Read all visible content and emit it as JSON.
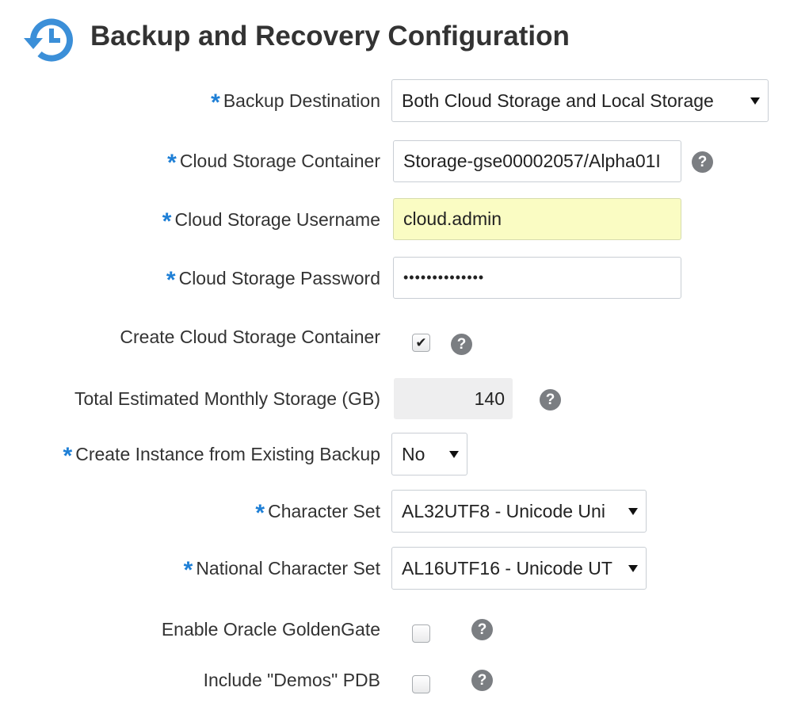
{
  "header": {
    "title": "Backup and Recovery Configuration",
    "icon": "backup-restore-clock-icon",
    "icon_color": "#3b8fd8"
  },
  "colors": {
    "required_marker": "#1e7fd6",
    "highlight_field": "#fafcc3",
    "readonly_field": "#eeeeef",
    "help_icon": "#7b7e82"
  },
  "form": {
    "required_marker": "*",
    "help_glyph": "?",
    "backup_destination": {
      "label": "Backup Destination",
      "value": "Both Cloud Storage and Local Storage",
      "required": true
    },
    "cloud_storage_container": {
      "label": "Cloud Storage Container",
      "value": "Storage-gse00002057/Alpha01I",
      "required": true
    },
    "cloud_storage_username": {
      "label": "Cloud Storage Username",
      "value": "cloud.admin",
      "required": true
    },
    "cloud_storage_password": {
      "label": "Cloud Storage Password",
      "value": "••••••••••••••",
      "required": true
    },
    "create_cloud_storage_container": {
      "label": "Create Cloud Storage Container",
      "checked": true,
      "check_glyph": "✔"
    },
    "total_estimated_monthly_storage": {
      "label": "Total Estimated Monthly Storage (GB)",
      "value": "140"
    },
    "create_instance_from_existing_backup": {
      "label": "Create Instance from Existing Backup",
      "value": "No",
      "required": true
    },
    "character_set": {
      "label": "Character Set",
      "value": "AL32UTF8 - Unicode Uni",
      "required": true
    },
    "national_character_set": {
      "label": "National Character Set",
      "value": "AL16UTF16 - Unicode UT",
      "required": true
    },
    "enable_oracle_goldengate": {
      "label": "Enable Oracle GoldenGate",
      "checked": false
    },
    "include_demos_pdb": {
      "label": "Include \"Demos\" PDB",
      "checked": false
    }
  }
}
